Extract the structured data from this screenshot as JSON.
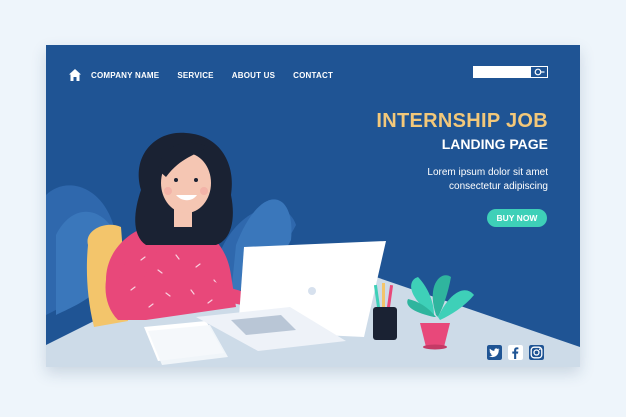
{
  "nav": {
    "home_icon": "home-icon",
    "links": [
      "COMPANY NAME",
      "SERVICE",
      "ABOUT US",
      "CONTACT"
    ]
  },
  "search": {
    "placeholder": "",
    "icon": "search-icon"
  },
  "hero": {
    "title": "INTERNSHIP JOB",
    "subtitle": "LANDING PAGE",
    "description": [
      "Lorem ipsum dolor sit amet",
      "consectetur adipiscing"
    ],
    "cta_label": "BUY NOW"
  },
  "social": [
    "twitter-icon",
    "facebook-icon",
    "instagram-icon"
  ],
  "colors": {
    "card_bg": "#1f5494",
    "title": "#f3c87a",
    "cta": "#3ed0b8",
    "desk": "#cddbe8",
    "shirt": "#e8487a"
  }
}
